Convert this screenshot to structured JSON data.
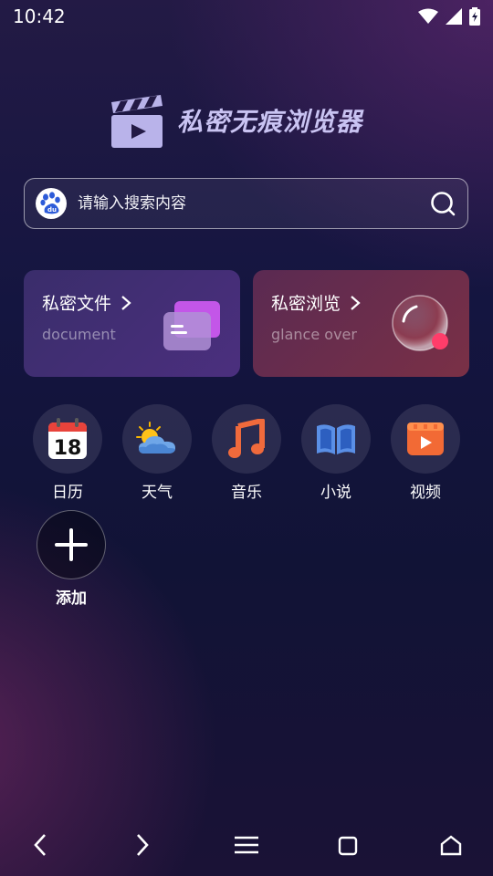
{
  "status_bar": {
    "time": "10:42"
  },
  "brand": {
    "title": "私密无痕浏览器"
  },
  "search": {
    "placeholder": "请输入搜索内容"
  },
  "cards": [
    {
      "title": "私密文件",
      "subtitle": "document"
    },
    {
      "title": "私密浏览",
      "subtitle": "glance over"
    }
  ],
  "apps": [
    {
      "label": "日历",
      "icon": "calendar-icon",
      "day": "18"
    },
    {
      "label": "天气",
      "icon": "weather-icon"
    },
    {
      "label": "音乐",
      "icon": "music-icon"
    },
    {
      "label": "小说",
      "icon": "book-icon"
    },
    {
      "label": "视频",
      "icon": "video-icon"
    },
    {
      "label": "添加",
      "icon": "plus-icon"
    }
  ],
  "colors": {
    "accent_brand": "#c9c3f2",
    "background": "#141540"
  }
}
